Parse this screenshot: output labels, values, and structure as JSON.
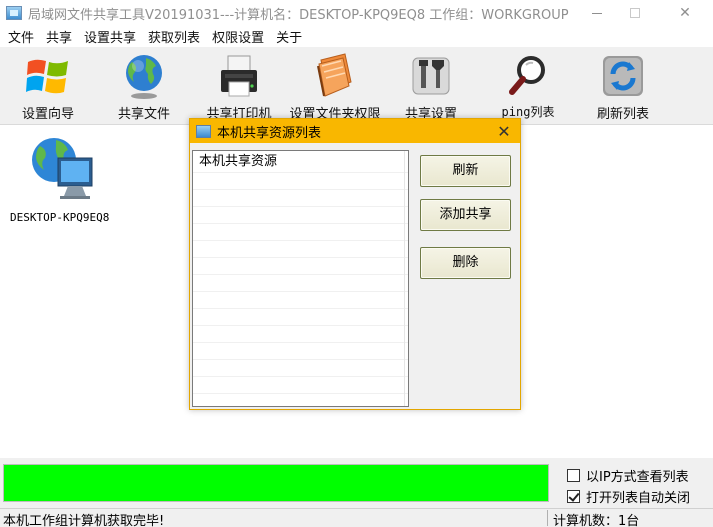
{
  "window": {
    "title": "局域网文件共享工具V20191031---计算机名：DESKTOP-KPQ9EQ8  工作组：WORKGROUP",
    "minimize_glyph": "—",
    "maximize_glyph": "□",
    "close_glyph": "✕"
  },
  "menu": [
    "文件",
    "共享",
    "设置共享",
    "获取列表",
    "权限设置",
    "关于"
  ],
  "toolbar": {
    "items": [
      {
        "label": "设置向导",
        "icon": "windows-logo-icon"
      },
      {
        "label": "共享文件",
        "icon": "globe-icon"
      },
      {
        "label": "共享打印机",
        "icon": "printer-icon"
      },
      {
        "label": "设置文件夹权限",
        "icon": "folder-book-icon"
      },
      {
        "label": "共享设置",
        "icon": "tools-icon"
      },
      {
        "label": "ping列表",
        "icon": "magnifier-icon"
      },
      {
        "label": "刷新列表",
        "icon": "refresh-icon"
      }
    ]
  },
  "workspace": {
    "computers": [
      {
        "name": "DESKTOP-KPQ9EQ8",
        "icon": "computer-globe-icon"
      }
    ]
  },
  "dialog": {
    "title": "本机共享资源列表",
    "close_glyph": "✕",
    "list_header": "本机共享资源",
    "buttons": {
      "refresh": "刷新",
      "add": "添加共享",
      "delete": "删除"
    }
  },
  "options": {
    "ip_view": {
      "label": "以IP方式查看列表",
      "checked": false
    },
    "auto_close": {
      "label": "打开列表自动关闭",
      "checked": true
    }
  },
  "progress": {
    "percent": 100,
    "color": "#00ff00"
  },
  "status": {
    "message": "本机工作组计算机获取完毕!",
    "count": "计算机数：1台"
  },
  "colors": {
    "dialog_title": "#f9b700",
    "progress": "#00ff00"
  }
}
